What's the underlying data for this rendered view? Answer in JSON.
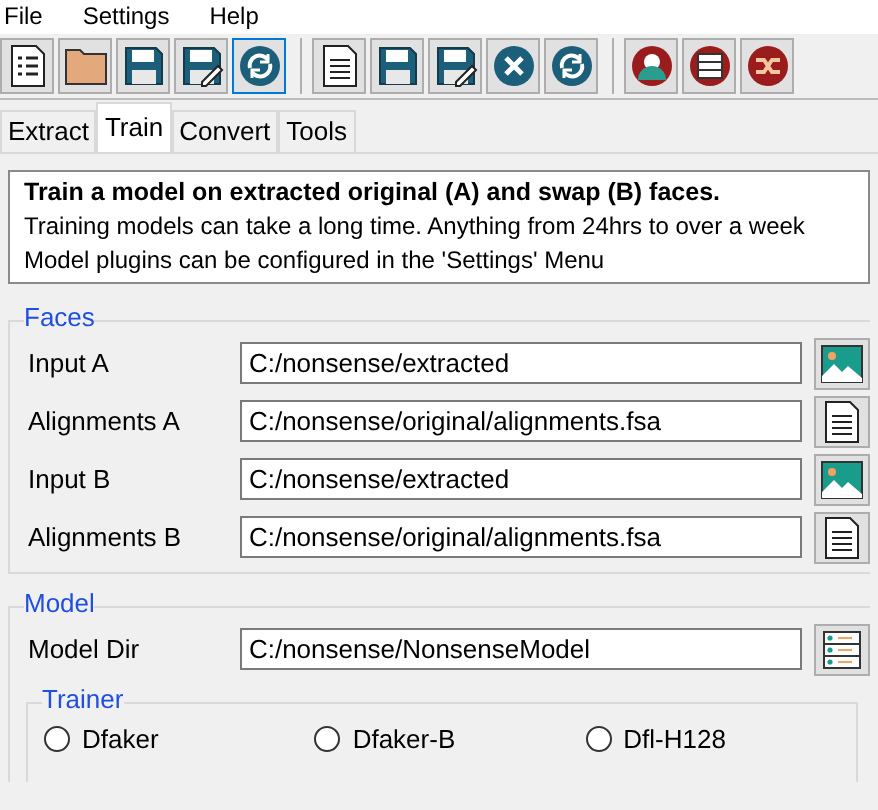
{
  "menu_bar": [
    "File",
    "Settings",
    "Help"
  ],
  "toolbar": [
    {
      "kind": "list",
      "focused": false
    },
    {
      "kind": "folder",
      "focused": false
    },
    {
      "kind": "save",
      "focused": false
    },
    {
      "kind": "save-edit",
      "focused": false
    },
    {
      "kind": "refresh",
      "focused": true
    },
    {
      "kind": "document",
      "focused": false
    },
    {
      "kind": "save",
      "focused": false
    },
    {
      "kind": "save-edit",
      "focused": false
    },
    {
      "kind": "close",
      "focused": false
    },
    {
      "kind": "refresh",
      "focused": false
    },
    {
      "kind": "person",
      "focused": false
    },
    {
      "kind": "rows",
      "focused": false
    },
    {
      "kind": "shuffle",
      "focused": false
    }
  ],
  "tabs": [
    {
      "label": "Extract",
      "selected": false
    },
    {
      "label": "Train",
      "selected": true
    },
    {
      "label": "Convert",
      "selected": false
    },
    {
      "label": "Tools",
      "selected": false
    }
  ],
  "info": {
    "title": "Train a model on extracted original (A) and swap (B) faces.",
    "lines": [
      "Training models can take a long time. Anything from 24hrs to over a week",
      "Model plugins can be configured in the 'Settings' Menu"
    ]
  },
  "faces": {
    "title": "Faces",
    "fields": [
      {
        "label": "Input A",
        "value": "C:/nonsense/extracted",
        "kind": "image"
      },
      {
        "label": "Alignments A",
        "value": "C:/nonsense/original/alignments.fsa",
        "kind": "file"
      },
      {
        "label": "Input B",
        "value": "C:/nonsense/extracted",
        "kind": "image"
      },
      {
        "label": "Alignments B",
        "value": "C:/nonsense/original/alignments.fsa",
        "kind": "file"
      }
    ]
  },
  "model": {
    "title": "Model",
    "fields": [
      {
        "label": "Model Dir",
        "value": "C:/nonsense/NonsenseModel",
        "kind": "folder"
      }
    ],
    "trainer": {
      "title": "Trainer",
      "options": [
        {
          "label": "Dfaker",
          "selected": false
        },
        {
          "label": "Dfaker-B",
          "selected": false
        },
        {
          "label": "Dfl-H128",
          "selected": false
        }
      ]
    }
  }
}
